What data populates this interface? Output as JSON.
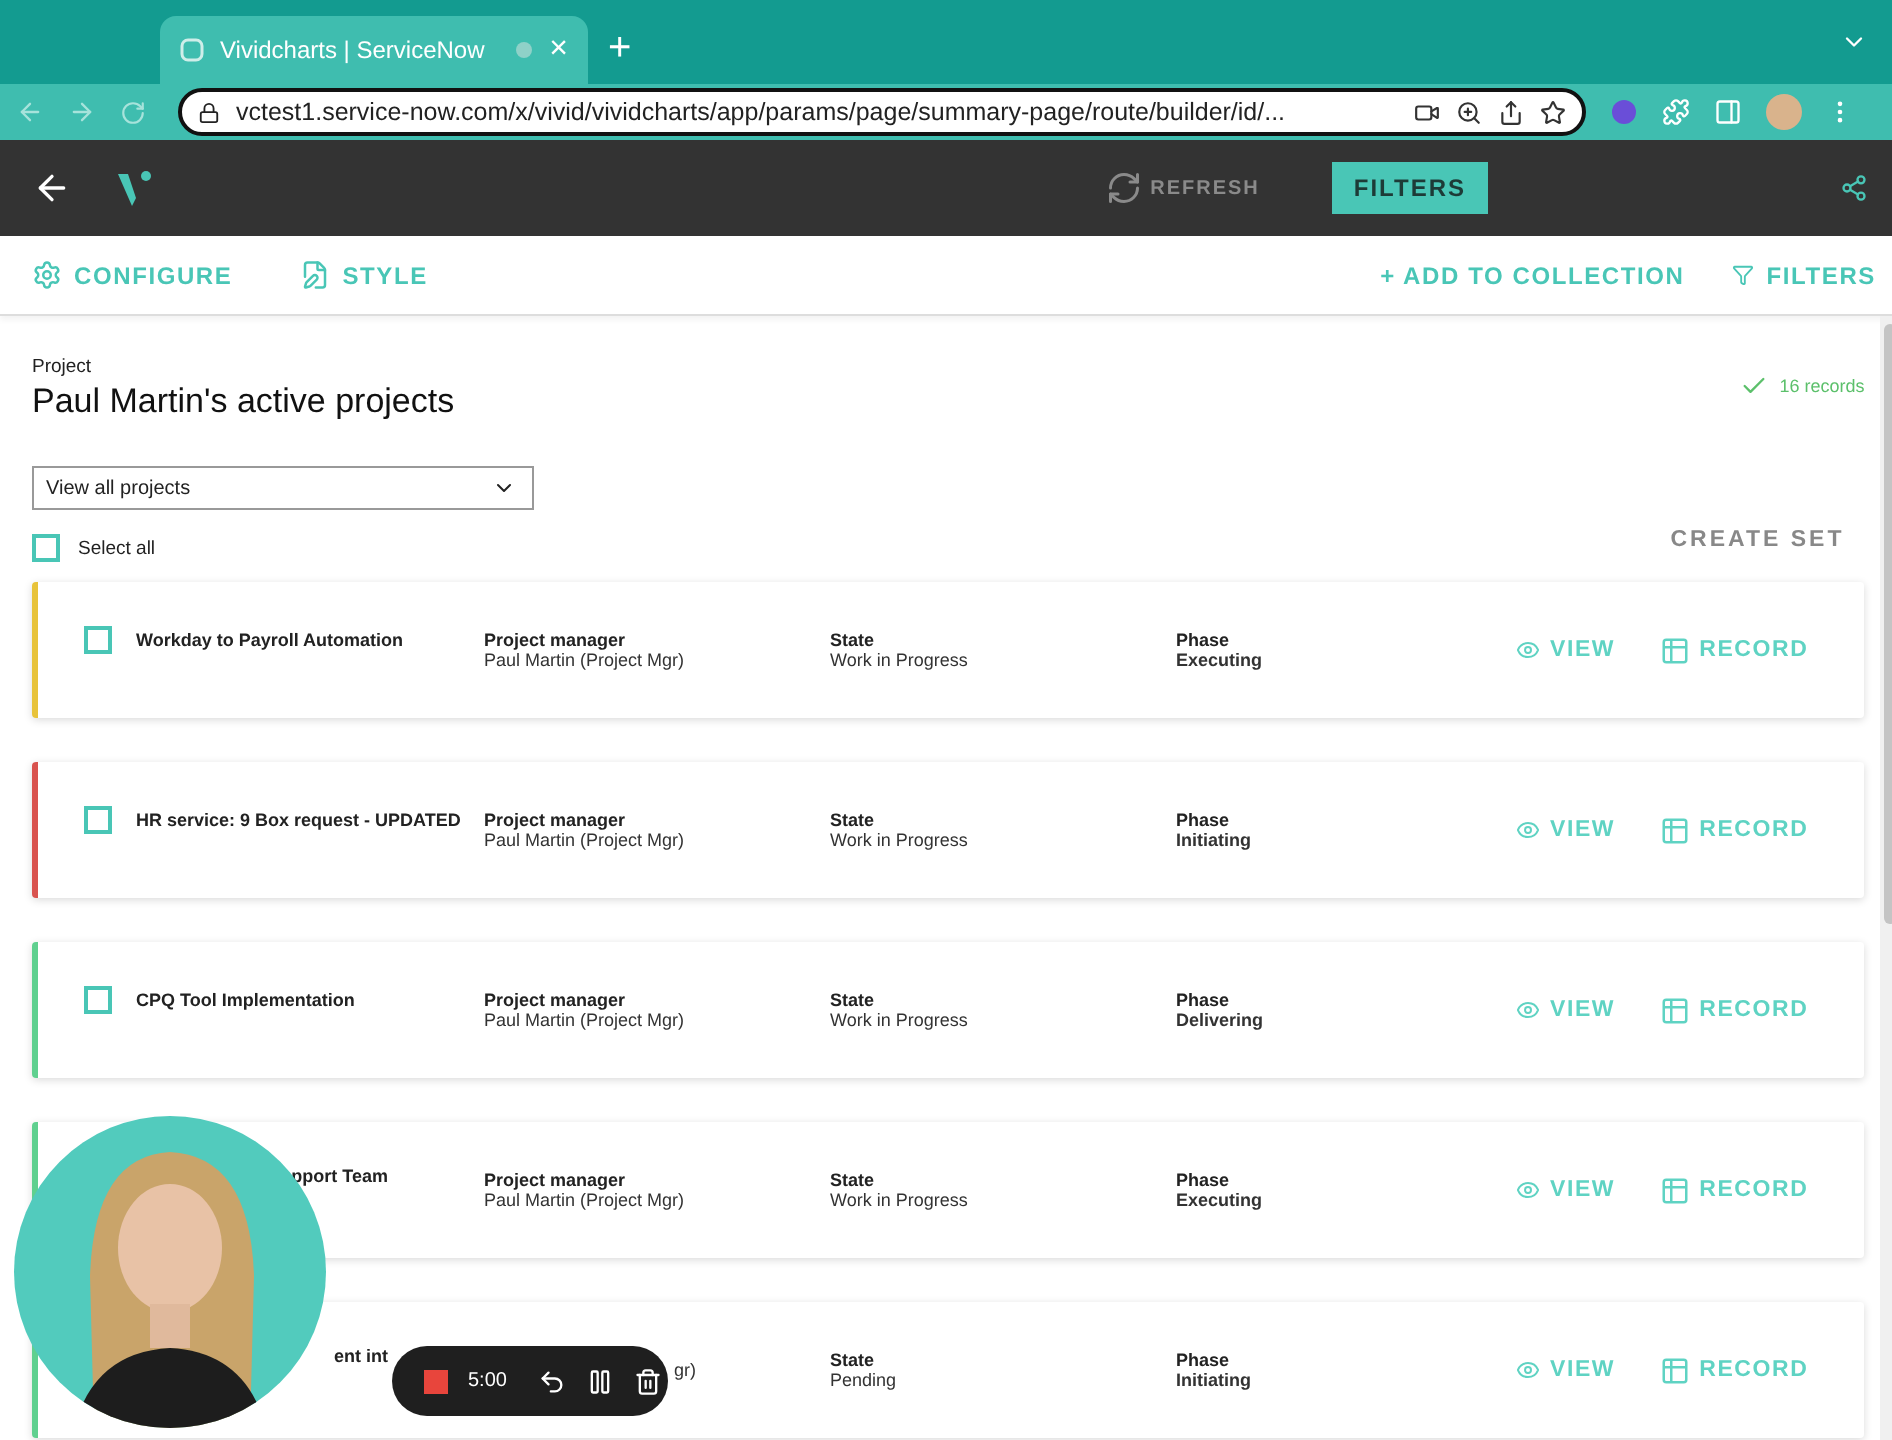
{
  "browser": {
    "tab_title": "Vividcharts | ServiceNow",
    "tab_close": "×",
    "new_tab": "+",
    "url": "vctest1.service-now.com/x/vivid/vividcharts/app/params/page/summary-page/route/builder/id/..."
  },
  "header": {
    "refresh": "REFRESH",
    "refresh_disabled": true,
    "filters": "FILTERS"
  },
  "toolbar": {
    "configure": "CONFIGURE",
    "style": "STYLE",
    "add_to_collection": "+ ADD TO COLLECTION",
    "filters": "FILTERS"
  },
  "page": {
    "eyebrow": "Project",
    "title": "Paul Martin's active projects",
    "records": "16 records",
    "dropdown": "View all projects",
    "select_all": {
      "label": "Select all",
      "checked": false
    },
    "create_set": "CREATE SET"
  },
  "rows": [
    {
      "kind": "full",
      "name": "Workday to Payroll Automation",
      "checked": false,
      "color": "#e8c33a",
      "manager_label": "Project manager",
      "manager": "Paul Martin (Project Mgr)",
      "state_label": "State",
      "state": "Work in Progress",
      "phase_label": "Phase",
      "phase": "Executing",
      "view": "VIEW",
      "record": "RECORD"
    },
    {
      "kind": "full",
      "name": "HR service: 9 Box request - UPDATED",
      "checked": false,
      "color": "#d9534f",
      "manager_label": "Project manager",
      "manager": "Paul Martin (Project Mgr)",
      "state_label": "State",
      "state": "Work in Progress",
      "phase_label": "Phase",
      "phase": "Initiating",
      "view": "VIEW",
      "record": "RECORD"
    },
    {
      "kind": "full",
      "name": "CPQ Tool Implementation",
      "checked": false,
      "color": "#5fd08f",
      "manager_label": "Project manager",
      "manager": "Paul Martin (Project Mgr)",
      "state_label": "State",
      "state": "Work in Progress",
      "phase_label": "Phase",
      "phase": "Delivering",
      "view": "VIEW",
      "record": "RECORD"
    },
    {
      "kind": "covered",
      "name": "pport Team",
      "color": "#5fd08f",
      "manager_label": "Project manager",
      "manager": "Paul Martin (Project Mgr)",
      "state_label": "State",
      "state": "Work in Progress",
      "phase_label": "Phase",
      "phase": "Executing",
      "view": "VIEW",
      "record": "RECORD"
    },
    {
      "kind": "covered",
      "name": "ent int",
      "color": "#5fd08f",
      "manager": "gr)",
      "state_label": "State",
      "state": "Pending",
      "phase_label": "Phase",
      "phase": "Initiating",
      "view": "VIEW",
      "record": "RECORD"
    }
  ],
  "recorder": {
    "time": "5:00"
  }
}
